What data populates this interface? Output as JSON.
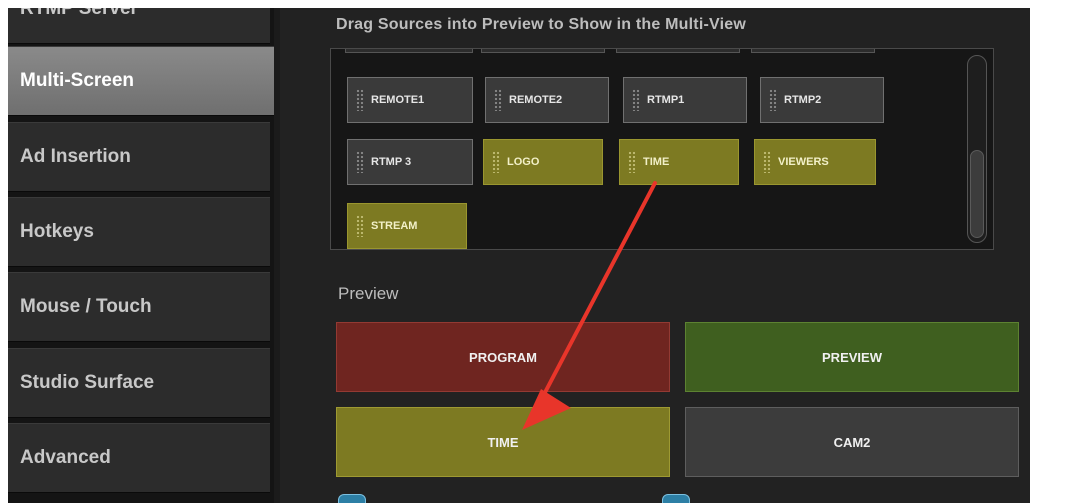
{
  "sidebar": {
    "items": [
      {
        "label": "RTMP Server",
        "active": false
      },
      {
        "label": "Multi-Screen",
        "active": true
      },
      {
        "label": "Ad Insertion",
        "active": false
      },
      {
        "label": "Hotkeys",
        "active": false
      },
      {
        "label": "Mouse / Touch",
        "active": false
      },
      {
        "label": "Studio Surface",
        "active": false
      },
      {
        "label": "Advanced",
        "active": false
      }
    ]
  },
  "main": {
    "hint": "Drag Sources into Preview to Show in the Multi-View",
    "sources": [
      {
        "label": "REMOTE1",
        "color": "gray"
      },
      {
        "label": "REMOTE2",
        "color": "gray"
      },
      {
        "label": "RTMP1",
        "color": "gray"
      },
      {
        "label": "RTMP2",
        "color": "gray"
      },
      {
        "label": "RTMP 3",
        "color": "gray"
      },
      {
        "label": "LOGO",
        "color": "yellow"
      },
      {
        "label": "TIME",
        "color": "yellow"
      },
      {
        "label": "VIEWERS",
        "color": "yellow"
      },
      {
        "label": "STREAM",
        "color": "yellow"
      }
    ],
    "preview_label": "Preview",
    "preview_slots": [
      {
        "label": "PROGRAM",
        "color": "#6f2520"
      },
      {
        "label": "PREVIEW",
        "color": "#3f5f1f"
      },
      {
        "label": "TIME",
        "color": "#7d7a22"
      },
      {
        "label": "CAM2",
        "color": "#3c3c3c"
      }
    ]
  },
  "annotation": {
    "color": "#e8352a"
  }
}
